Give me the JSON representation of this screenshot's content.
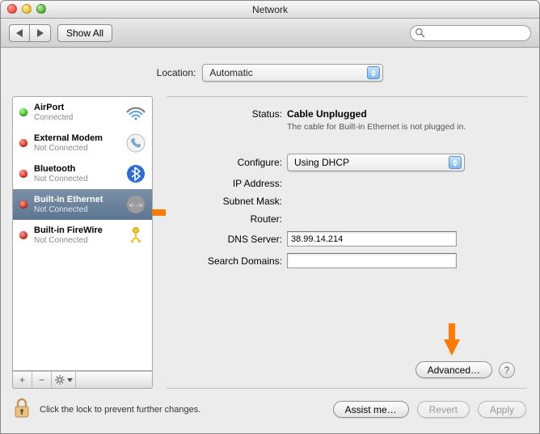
{
  "window": {
    "title": "Network"
  },
  "toolbar": {
    "show_all": "Show All",
    "search_placeholder": ""
  },
  "location": {
    "label": "Location:",
    "value": "Automatic"
  },
  "services": [
    {
      "name": "AirPort",
      "status": "Connected",
      "state": "green",
      "icon": "wifi",
      "selected": false
    },
    {
      "name": "External Modem",
      "status": "Not Connected",
      "state": "red",
      "icon": "phone",
      "selected": false
    },
    {
      "name": "Bluetooth",
      "status": "Not Connected",
      "state": "red",
      "icon": "bluetooth",
      "selected": false
    },
    {
      "name": "Built-in Ethernet",
      "status": "Not Connected",
      "state": "red",
      "icon": "ethernet",
      "selected": true
    },
    {
      "name": "Built-in FireWire",
      "status": "Not Connected",
      "state": "red",
      "icon": "firewire",
      "selected": false
    }
  ],
  "detail": {
    "status_label": "Status:",
    "status_value": "Cable Unplugged",
    "status_desc": "The cable for Built-in Ethernet is not plugged in.",
    "configure_label": "Configure:",
    "configure_value": "Using DHCP",
    "ip_label": "IP Address:",
    "ip_value": "",
    "subnet_label": "Subnet Mask:",
    "subnet_value": "",
    "router_label": "Router:",
    "router_value": "",
    "dns_label": "DNS Server:",
    "dns_value": "38.99.14.214",
    "search_label": "Search Domains:",
    "search_value": "",
    "advanced": "Advanced…"
  },
  "bottom": {
    "lock_text": "Click the lock to prevent further changes.",
    "assist": "Assist me…",
    "revert": "Revert",
    "apply": "Apply"
  },
  "sidebar_buttons": {
    "add": "+",
    "remove": "−",
    "gear": "✿"
  }
}
